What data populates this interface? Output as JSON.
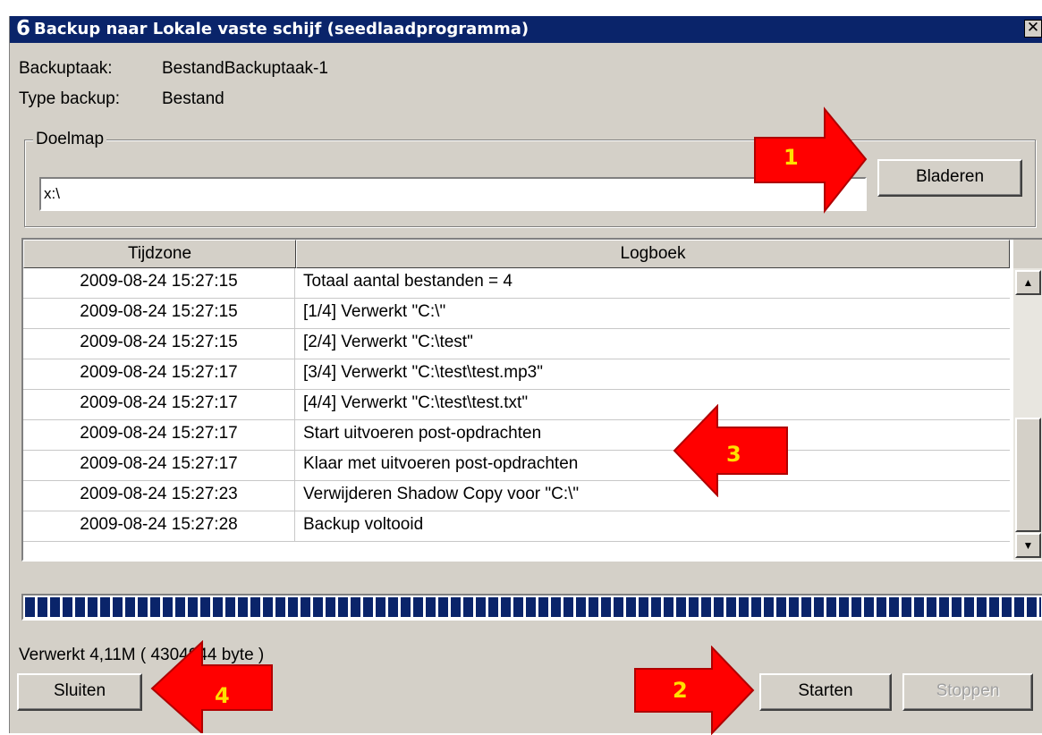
{
  "window": {
    "title": "Backup naar Lokale vaste schijf (seedlaadprogramma)",
    "app_icon": "6",
    "close_glyph": "✕"
  },
  "info": {
    "task_label": "Backuptaak:",
    "task_value": "BestandBackuptaak-1",
    "type_label": "Type backup:",
    "type_value": "Bestand"
  },
  "target": {
    "group_label": "Doelmap",
    "path_value": "x:\\",
    "browse_label": "Bladeren"
  },
  "log": {
    "columns": [
      "Tijdzone",
      "Logboek"
    ],
    "rows": [
      {
        "time": "2009-08-24 15:27:15",
        "message": "Totaal aantal bestanden = 4"
      },
      {
        "time": "2009-08-24 15:27:15",
        "message": "[1/4] Verwerkt \"C:\\\""
      },
      {
        "time": "2009-08-24 15:27:15",
        "message": "[2/4] Verwerkt \"C:\\test\""
      },
      {
        "time": "2009-08-24 15:27:17",
        "message": "[3/4] Verwerkt \"C:\\test\\test.mp3\""
      },
      {
        "time": "2009-08-24 15:27:17",
        "message": "[4/4] Verwerkt \"C:\\test\\test.txt\""
      },
      {
        "time": "2009-08-24 15:27:17",
        "message": "Start uitvoeren post-opdrachten"
      },
      {
        "time": "2009-08-24 15:27:17",
        "message": "Klaar met uitvoeren post-opdrachten"
      },
      {
        "time": "2009-08-24 15:27:23",
        "message": "Verwijderen Shadow Copy voor \"C:\\\""
      },
      {
        "time": "2009-08-24 15:27:28",
        "message": "Backup voltooid"
      }
    ]
  },
  "progress": {
    "fraction": 1.0,
    "status_text": "Verwerkt 4,11M ( 4304944 byte )"
  },
  "buttons": {
    "close_label": "Sluiten",
    "start_label": "Starten",
    "stop_label": "Stoppen"
  },
  "annotations": {
    "arrow_1": "1",
    "arrow_2": "2",
    "arrow_3": "3",
    "arrow_4": "4",
    "arrow_color": "#ff0000",
    "number_color": "#ffe000"
  }
}
